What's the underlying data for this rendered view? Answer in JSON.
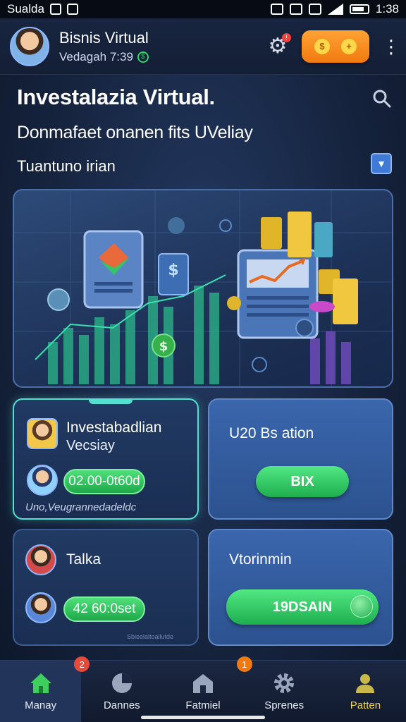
{
  "status_bar": {
    "carrier": "Sualda",
    "time": "1:38"
  },
  "header": {
    "user_name": "Bisnis Virtual",
    "user_subtitle": "Vedagah 7:39",
    "notification_count": "!"
  },
  "title_area": {
    "title": "Investalazia Virtual.",
    "subtitle": "Donmafaet onanen fits UVeliay",
    "filter_label": "Tuantuno irian"
  },
  "cards": [
    {
      "title": "Investabadlian",
      "subtitle": "Vecsiay",
      "pill_value": "02.00-0t60d",
      "note": "Uno,Veugrannedadeldc"
    },
    {
      "title": "U20 Bs ation",
      "button_label": "BIX"
    },
    {
      "title": "Talka",
      "pill_value": "42 60:0set",
      "caption": "Sbieelaltoallutde"
    },
    {
      "title": "Vtorinmin",
      "button_label": "19DSAIN"
    }
  ],
  "bottom_nav": {
    "items": [
      {
        "label": "Manay",
        "badge": "2",
        "active": true
      },
      {
        "label": "Dannes",
        "badge": "",
        "active": false
      },
      {
        "label": "Fatmiel",
        "badge": "1",
        "active": false
      },
      {
        "label": "Sprenes",
        "badge": "",
        "active": false
      },
      {
        "label": "Patten",
        "badge": "",
        "active": false
      }
    ]
  },
  "colors": {
    "accent_orange": "#f08a1c",
    "accent_green": "#2fc15e",
    "glow_teal": "#54e0d0",
    "badge_red": "#e84a3a",
    "badge_orange": "#f07a10"
  }
}
